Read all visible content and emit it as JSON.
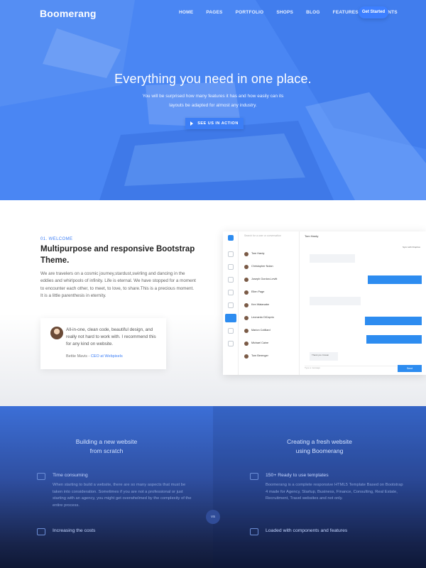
{
  "nav": {
    "logo": "Boomerang",
    "links": [
      "HOME",
      "PAGES",
      "PORTFOLIO",
      "SHOPS",
      "BLOG",
      "FEATURES",
      "ELEMENTS"
    ],
    "cta": "Get Started"
  },
  "hero": {
    "title": "Everything you need in one place.",
    "subtitle": "You will be surprised how many features it has and how easily can its layouts be adapted for almost any industry.",
    "button": "SEE US IN ACTION"
  },
  "welcome": {
    "kicker": "01. WELCOME",
    "title": "Multipurpose and responsive Bootstrap Theme.",
    "text": "We are travelers on a cosmic journey,stardust,swirling and dancing in the eddies and whirlpools of infinity. Life is eternal. We have stopped for a moment to encounter each other, to meet, to love, to share.This is a precious moment. It is a little parenthesis in eternity.",
    "quote": {
      "text": "All-in-one, clean code, beautiful design, and really not hard to work with. I recommend this for any kind on website.",
      "author": "Bettie Mavis",
      "role": "CEO at Webpixels"
    }
  },
  "mockup": {
    "search": "Search for a user or conversation",
    "contact_name": "Tom Hardy",
    "contacts": [
      {
        "name": "Tom Hardy",
        "time": ""
      },
      {
        "name": "Christopher Nolan",
        "time": ""
      },
      {
        "name": "Joseph Gordon-Levitt",
        "time": ""
      },
      {
        "name": "Ellen Page",
        "time": ""
      },
      {
        "name": "Ken Watanabe",
        "time": ""
      },
      {
        "name": "Leonardo DiCaprio",
        "time": ""
      },
      {
        "name": "Marion Cotillard",
        "time": ""
      },
      {
        "name": "Michael Caine",
        "time": ""
      },
      {
        "name": "Tom Berenger",
        "time": ""
      }
    ],
    "chat": {
      "m1": "",
      "m2": "",
      "m3": "",
      "m4": "",
      "m5": "",
      "m6": "Thank you Cowan",
      "m7": "Sync with Dropbox"
    },
    "input": "Type a message",
    "send": "Send"
  },
  "features": {
    "left": {
      "heading_line1": "Building a new website",
      "heading_line2": "from scratch",
      "items": [
        {
          "title": "Time consuming",
          "text": "When starting to build a website, there are so many aspects that must be taken into consideration. Sometimes if you are not a professional or just starting with an agency, you might get overwhelmed by the complexity of the entire process."
        },
        {
          "title": "Increasing the costs",
          "text": ""
        }
      ]
    },
    "right": {
      "heading_line1": "Creating a fresh website",
      "heading_line2": "using Boomerang",
      "items": [
        {
          "title": "150+ Ready to use templates",
          "text": "Boomerang is a complete responsive HTML5 Template Based on Bootstrap 4 made for Agency, Startup, Business, Finance, Consulting, Real Estate, Recruitment, Travel websites and not only."
        },
        {
          "title": "Loaded with components and features",
          "text": ""
        }
      ]
    },
    "vs": "VS"
  }
}
